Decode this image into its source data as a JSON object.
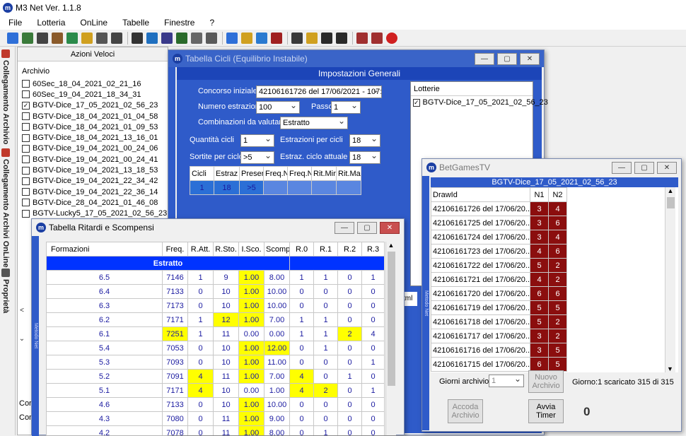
{
  "app": {
    "title": "M3 Net  Ver. 1.1.8",
    "logo_text": "m"
  },
  "window_controls": {
    "minimize": "—",
    "maximize": "▢",
    "close": "✕"
  },
  "menu": [
    "File",
    "Lotteria",
    "OnLine",
    "Tabelle",
    "Finestre",
    "?"
  ],
  "toolbar_icons": [
    "connect-icon",
    "network-icon",
    "move-icon",
    "network2-icon",
    "tree-icon",
    "refresh-icon",
    "user-icon",
    "chart-icon",
    "print-icon",
    "find-icon",
    "chart2-icon",
    "chart3-icon",
    "target-icon",
    "settings-icon",
    "list-icon",
    "folder-icon",
    "globe-icon",
    "tools-icon",
    "edit-icon",
    "open-folder-icon",
    "save-icon",
    "save-all-icon",
    "tools2-icon",
    "settings2-icon",
    "exit-icon"
  ],
  "side_tabs": [
    "Collegamento Archivio",
    "Collegamento Archivi OnLine",
    "Proprietà"
  ],
  "azioni": {
    "title": "Azioni Veloci",
    "archivio_label": "Archivio",
    "items": [
      {
        "name": "60Sec_18_04_2021_02_21_16",
        "checked": false
      },
      {
        "name": "60Sec_19_04_2021_18_34_31",
        "checked": false
      },
      {
        "name": "BGTV-Dice_17_05_2021_02_56_23",
        "checked": true
      },
      {
        "name": "BGTV-Dice_18_04_2021_01_04_58",
        "checked": false
      },
      {
        "name": "BGTV-Dice_18_04_2021_01_09_53",
        "checked": false
      },
      {
        "name": "BGTV-Dice_18_04_2021_13_16_01",
        "checked": false
      },
      {
        "name": "BGTV-Dice_19_04_2021_00_24_06",
        "checked": false
      },
      {
        "name": "BGTV-Dice_19_04_2021_00_24_41",
        "checked": false
      },
      {
        "name": "BGTV-Dice_19_04_2021_13_18_53",
        "checked": false
      },
      {
        "name": "BGTV-Dice_19_04_2021_22_34_42",
        "checked": false
      },
      {
        "name": "BGTV-Dice_19_04_2021_22_36_14",
        "checked": false
      },
      {
        "name": "BGTV-Dice_28_04_2021_01_46_08",
        "checked": false
      },
      {
        "name": "BGTV-Lucky5_17_05_2021_02_56_23",
        "checked": false
      }
    ],
    "bottom_labels": [
      "Cor",
      "Cor"
    ]
  },
  "side_strip_text": "Metodo Net",
  "cicli": {
    "title": "Tabella Cicli (Equilibrio Instabile)",
    "section_title": "Impostazioni Generali",
    "concorso_label": "Concorso iniziale",
    "concorso_value": "42106161726 del 17/06/2021 - 107:",
    "num_estr_label": "Numero estrazioni",
    "num_estr_value": "100",
    "passo_label": "Passo",
    "passo_value": "1",
    "comb_label": "Combinazioni da valutare",
    "comb_value": "Estratto",
    "qty_label": "Quantità cicli",
    "qty_value": "1",
    "estr_per_cicli_label": "Estrazioni per cicli",
    "estr_per_cicli_value": "18",
    "sortite_label": "Sortite per ciclo",
    "sortite_value": ">5",
    "estraz_ciclo_label": "Estraz. ciclo attuale",
    "estraz_ciclo_value": "18",
    "lotterie_header": "Lotterie",
    "lotterie_item": "BGTV-Dice_17_05_2021_02_56_23",
    "grid_headers": [
      "Cicli",
      "Estraz",
      "Preser",
      "Freq.N",
      "Freq.N",
      "Rit.Mir",
      "Rit.Ma"
    ],
    "grid_row": [
      "1",
      "18",
      ">5",
      "",
      "",
      "",
      ""
    ],
    "partial_text": "tml"
  },
  "ritardi": {
    "title": "Tabella Ritardi e Scompensi",
    "headers": [
      "Formazioni",
      "Freq.",
      "R.Att.",
      "R.Sto.",
      "I.Sco.",
      "Scomp",
      "R.0",
      "R.1",
      "R.2",
      "R.3"
    ],
    "group_label": "Estratto",
    "rows": [
      [
        "6.5",
        "7146",
        "1",
        "9",
        "1.00",
        "8.00",
        "1",
        "1",
        "0",
        "1"
      ],
      [
        "6.4",
        "7133",
        "0",
        "10",
        "1.00",
        "10.00",
        "0",
        "0",
        "0",
        "0"
      ],
      [
        "6.3",
        "7173",
        "0",
        "10",
        "1.00",
        "10.00",
        "0",
        "0",
        "0",
        "0"
      ],
      [
        "6.2",
        "7171",
        "1",
        "12",
        "1.00",
        "7.00",
        "1",
        "1",
        "0",
        "0"
      ],
      [
        "6.1",
        "7251",
        "1",
        "11",
        "0.00",
        "0.00",
        "1",
        "1",
        "2",
        "4"
      ],
      [
        "5.4",
        "7053",
        "0",
        "10",
        "1.00",
        "12.00",
        "0",
        "1",
        "0",
        "0"
      ],
      [
        "5.3",
        "7093",
        "0",
        "10",
        "1.00",
        "11.00",
        "0",
        "0",
        "0",
        "1"
      ],
      [
        "5.2",
        "7091",
        "4",
        "11",
        "1.00",
        "7.00",
        "4",
        "0",
        "1",
        "0"
      ],
      [
        "5.1",
        "7171",
        "4",
        "10",
        "0.00",
        "1.00",
        "4",
        "2",
        "0",
        "1"
      ],
      [
        "4.6",
        "7133",
        "0",
        "10",
        "1.00",
        "10.00",
        "0",
        "0",
        "0",
        "0"
      ],
      [
        "4.3",
        "7080",
        "0",
        "11",
        "1.00",
        "9.00",
        "0",
        "0",
        "0",
        "0"
      ],
      [
        "4.2",
        "7078",
        "0",
        "11",
        "1.00",
        "8.00",
        "0",
        "1",
        "0",
        "0"
      ]
    ],
    "highlights": [
      [
        0,
        4
      ],
      [
        1,
        4
      ],
      [
        2,
        4
      ],
      [
        3,
        3
      ],
      [
        3,
        4
      ],
      [
        4,
        1
      ],
      [
        5,
        4
      ],
      [
        5,
        5
      ],
      [
        6,
        4
      ],
      [
        7,
        2
      ],
      [
        7,
        4
      ],
      [
        7,
        6
      ],
      [
        8,
        2
      ],
      [
        8,
        6
      ],
      [
        8,
        7
      ],
      [
        9,
        4
      ],
      [
        10,
        4
      ],
      [
        11,
        4
      ],
      [
        4,
        8
      ]
    ]
  },
  "betgames": {
    "title": "BetGamesTV",
    "subtitle": "BGTV-Dice_17_05_2021_02_56_23",
    "headers": [
      "DrawId",
      "N1",
      "N2"
    ],
    "rows": [
      [
        "42106161726 del 17/06/20...",
        "3",
        "4"
      ],
      [
        "42106161725 del 17/06/20...",
        "3",
        "6"
      ],
      [
        "42106161724 del 17/06/20...",
        "3",
        "4"
      ],
      [
        "42106161723 del 17/06/20...",
        "4",
        "6"
      ],
      [
        "42106161722 del 17/06/20...",
        "5",
        "2"
      ],
      [
        "42106161721 del 17/06/20...",
        "4",
        "2"
      ],
      [
        "42106161720 del 17/06/20...",
        "6",
        "6"
      ],
      [
        "42106161719 del 17/06/20...",
        "5",
        "5"
      ],
      [
        "42106161718 del 17/06/20...",
        "5",
        "2"
      ],
      [
        "42106161717 del 17/06/20...",
        "3",
        "2"
      ],
      [
        "42106161716 del 17/06/20...",
        "3",
        "5"
      ],
      [
        "42106161715 del 17/06/20...",
        "6",
        "5"
      ]
    ],
    "giorni_label": "Giorni archivio",
    "giorni_value": "1",
    "nuovo_archivio": "Nuovo Archivio",
    "status": "Giorno:1 scaricato 315 di 315",
    "accoda": "Accoda Archivio",
    "avvia": "Avvia Timer",
    "counter": "0"
  }
}
